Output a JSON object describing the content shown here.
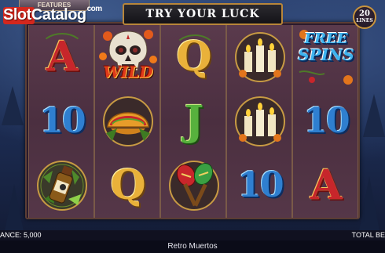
{
  "logo": {
    "part1": "Slot",
    "part2": "Catalog",
    "part3": "com"
  },
  "features_tab": "FEATURES",
  "banner_text": "TRY YOUR LUCK",
  "lines_badge": {
    "number": "20",
    "label": "LINES"
  },
  "symbols": {
    "wild_label": "WILD",
    "free_spins_line1": "FREE",
    "free_spins_line2": "SPINS",
    "letters": {
      "A": "A",
      "Q": "Q",
      "J": "J",
      "ten": "10"
    }
  },
  "reel_grid": [
    [
      "A",
      "skull-wild",
      "Q",
      "candles",
      "free-spins"
    ],
    [
      "10",
      "taco",
      "J",
      "candles",
      "10"
    ],
    [
      "tequila",
      "Q",
      "maracas",
      "10",
      "A"
    ]
  ],
  "status": {
    "balance": "ANCE: 5,000",
    "total_bet": "TOTAL BE"
  },
  "game_name": "Retro Muertos",
  "colors": {
    "reel_bg": "#4b2f40",
    "frame": "#5b3d34",
    "banner_border": "#b8863a",
    "sky": "#253a66"
  }
}
